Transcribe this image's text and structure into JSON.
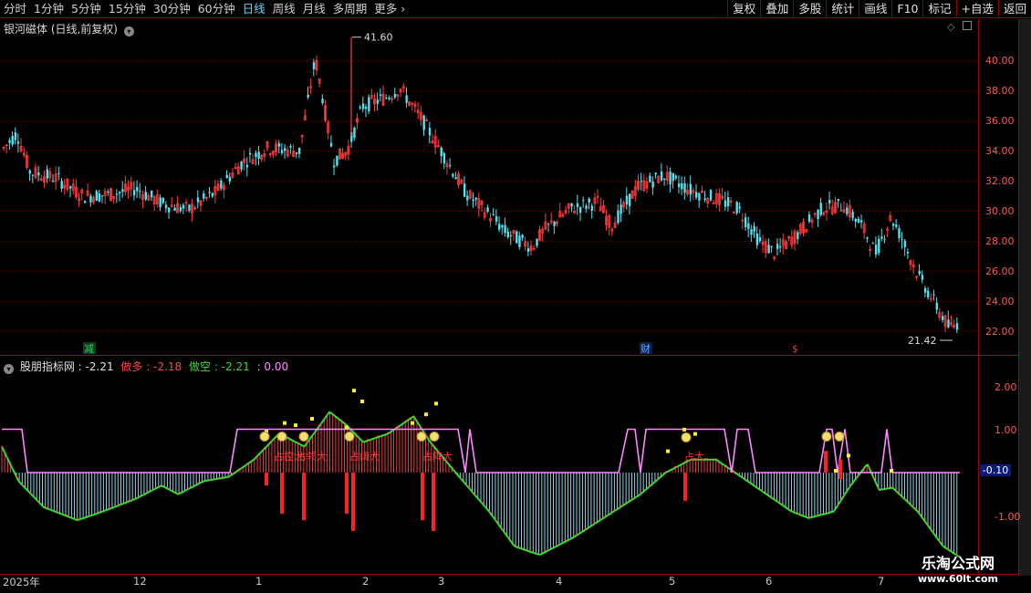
{
  "toolbar": {
    "periods": [
      "分时",
      "1分钟",
      "5分钟",
      "15分钟",
      "30分钟",
      "60分钟",
      "日线",
      "周线",
      "月线",
      "多周期",
      "更多"
    ],
    "active_period": "日线",
    "right_tools": [
      "复权",
      "叠加",
      "多股",
      "统计",
      "画线",
      "F10",
      "标记",
      "+自选",
      "返回"
    ]
  },
  "price_pane": {
    "title": "银河磁体 (日线,前复权)",
    "high_label": "41.60",
    "low_label": "21.42",
    "y_ticks": [
      "40.00",
      "38.00",
      "36.00",
      "34.00",
      "32.00",
      "30.00",
      "28.00",
      "26.00",
      "24.00",
      "22.00"
    ],
    "markers": [
      {
        "text": "减",
        "color": "#33cc66"
      },
      {
        "text": "财",
        "color": "#5fa8ff"
      },
      {
        "text": "$",
        "color": "#ff3333"
      }
    ],
    "colors": {
      "up": "#ff3b3b",
      "down": "#54e1f0"
    }
  },
  "indicator_pane": {
    "name": "股朋指标网",
    "value": ": -2.21",
    "long_label": "做多",
    "long_value": ": -2.18",
    "short_label": "做空",
    "short_value": ": -2.21",
    "extra": ": 0.00",
    "y_ticks": [
      "2.00",
      "1.00",
      "-1.00"
    ],
    "current_value": "-0.10",
    "annotations": [
      "占控大",
      "占领大",
      "占阔大",
      "占阵大",
      "占大"
    ],
    "colors": {
      "long": "#ff4444",
      "short": "#33dd33",
      "band": "#ff88ff",
      "histo_pos": "#ff4444",
      "histo_neg": "#9fe8ff"
    }
  },
  "date_axis": {
    "labels": [
      "2025年",
      "12",
      "1",
      "2",
      "3",
      "4",
      "5",
      "6",
      "7"
    ]
  },
  "watermark": {
    "line1": "乐淘公式网",
    "line2": "www.60lt.com"
  }
}
